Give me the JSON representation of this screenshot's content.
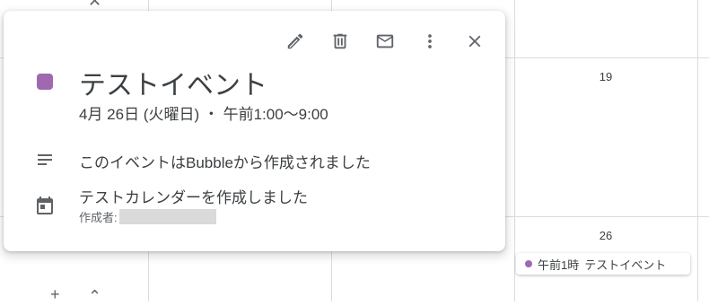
{
  "calendar": {
    "day_numbers": [
      "19",
      "26"
    ],
    "event_chip": {
      "time": "午前1時",
      "title": "テストイベント",
      "color": "#9e69af"
    }
  },
  "popup": {
    "toolbar": {
      "edit_icon": "pencil-icon",
      "delete_icon": "trash-icon",
      "email_icon": "mail-icon",
      "more_icon": "more-vert-icon",
      "close_icon": "close-icon"
    },
    "event_color": "#9e69af",
    "title": "テストイベント",
    "datetime": "4月 26日 (火曜日) ・ 午前1:00～9:00",
    "description": "このイベントはBubbleから作成されました",
    "calendar_name": "テストカレンダーを作成しました",
    "creator_label": "作成者:"
  }
}
